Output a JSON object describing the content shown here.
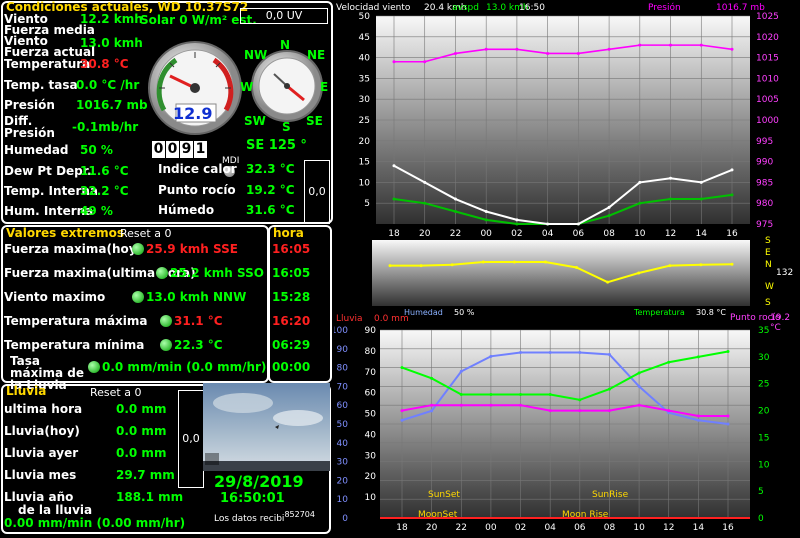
{
  "current": {
    "title": "Condiciones actuales, WD 10.37S72",
    "solar": "Solar 0 W/m² est.",
    "uv_box": "0,0 UV",
    "rows": [
      {
        "label": "Viento",
        "value": "12.2 kmh"
      },
      {
        "label": "Fuerza media",
        "value": ""
      },
      {
        "label": "Viento",
        "value": "13.0 kmh"
      },
      {
        "label": "Fuerza actual",
        "value": ""
      },
      {
        "label": "Temperatura",
        "value": "30.8 °C"
      },
      {
        "label": "Temp. tasa",
        "value": "0.0 °C /hr"
      },
      {
        "label": "Presión",
        "value": "1016.7 mb"
      },
      {
        "label": "Diff.",
        "value": "-0.1mb/hr"
      },
      {
        "label": "Presión",
        "value": ""
      },
      {
        "label": "Humedad",
        "value": "50 %"
      },
      {
        "label": "Dew Pt Depr.",
        "value": "11.6 °C"
      },
      {
        "label": "Temp. Interna",
        "value": "32.2 °C"
      },
      {
        "label": "Hum. Interna",
        "value": "49 %"
      }
    ],
    "gauge_value": "12.9",
    "counter": [
      "0",
      "0",
      "9",
      "1"
    ],
    "compass": {
      "N": "N",
      "NE": "NE",
      "E": "E",
      "SE": "SE",
      "S": "S",
      "SW": "SW",
      "W": "W",
      "NW": "NW"
    },
    "direction": "SE  125 °",
    "mdi": "MDI",
    "heat_label": "Indice calor",
    "heat_value": "32.3 °C",
    "dew_label": "Punto rocío",
    "dew_value": "19.2 °C",
    "humid_label": "Húmedo",
    "humid_value": "31.6 °C",
    "side_box": "0,0"
  },
  "extremes": {
    "title": "Valores extremos",
    "reset": "Reset a 0",
    "hora_title": "hora",
    "rows": [
      {
        "label": "Fuerza maxima(hoy)",
        "value": "25.9 kmh SSE",
        "time": "16:05",
        "red": true
      },
      {
        "label": "Fuerza maxima(ultima hora)",
        "value": "25.2 kmh SSO",
        "time": "16:05",
        "red": false
      },
      {
        "label": "Viento maximo",
        "value": "13.0 kmh NNW",
        "time": "15:28",
        "red": false
      },
      {
        "label": "Temperatura máxima",
        "value": "31.1 °C",
        "time": "16:20",
        "red": true
      },
      {
        "label": "Temperatura mínima",
        "value": "22.3 °C",
        "time": "06:29",
        "red": false
      },
      {
        "label": "Tasa máxima de la Lluvia",
        "value": "0.0 mm/min (0.0 mm/hr)",
        "time": "00:00",
        "red": false
      }
    ]
  },
  "rain": {
    "title": "Lluvia",
    "reset": "Reset a 0",
    "rows": [
      {
        "label": "ultima hora",
        "value": "0.0 mm"
      },
      {
        "label": "Lluvia(hoy)",
        "value": "0.0 mm"
      },
      {
        "label": "Lluvia ayer",
        "value": "0.0 mm"
      },
      {
        "label": "Lluvia mes",
        "value": "29.7 mm"
      },
      {
        "label": "Lluvia año",
        "value": "188.1 mm"
      },
      {
        "label": "de la lluvia",
        "value": ""
      }
    ],
    "rate": "0.00 mm/min (0.00 mm/hr)",
    "side_box": "0,0"
  },
  "footer": {
    "date": "29/8/2019",
    "time": "16:50:01",
    "received": "Los datos recibi",
    "received_num": "852704"
  },
  "colors": {
    "green": "#00ff00",
    "red": "#ff2020",
    "yellow": "#ffd800",
    "magenta": "#ff00ff"
  },
  "chart_data": [
    {
      "type": "line",
      "title": "",
      "header": {
        "wind_label": "Velocidad viento",
        "wind_val": "20.4 kmh",
        "avspd": "avspd",
        "avspd_val": "13.0 kmh",
        "time": "16:50",
        "pres_label": "Presión",
        "pres_val": "1016.7 mb"
      },
      "x": [
        "18",
        "20",
        "22",
        "00",
        "02",
        "04",
        "06",
        "08",
        "10",
        "12",
        "14",
        "16"
      ],
      "y_left": {
        "ylim": [
          0,
          50
        ],
        "ticks": [
          "5",
          "10",
          "15",
          "20",
          "25",
          "30",
          "35",
          "40",
          "45",
          "50"
        ]
      },
      "y_right": {
        "ylim": [
          975,
          1025
        ],
        "ticks": [
          "975",
          "980",
          "985",
          "990",
          "995",
          "1000",
          "1005",
          "1010",
          "1015",
          "1020",
          "1025"
        ]
      },
      "series": [
        {
          "name": "Presión",
          "color": "#ff00ff",
          "values": [
            1014,
            1014,
            1016,
            1017,
            1017,
            1016,
            1016,
            1017,
            1018,
            1018,
            1018,
            1017
          ]
        },
        {
          "name": "avspd",
          "color": "#00c000",
          "values": [
            6,
            5,
            3,
            1,
            0,
            0,
            0,
            2,
            5,
            6,
            6,
            7
          ]
        },
        {
          "name": "Velocidad viento",
          "color": "#ffffff",
          "values": [
            14,
            10,
            6,
            3,
            1,
            0,
            0,
            4,
            10,
            11,
            10,
            13
          ]
        }
      ]
    },
    {
      "type": "line",
      "title": "",
      "right_labels": [
        "S",
        "E",
        "N",
        "W",
        "S"
      ],
      "right_value": "132",
      "x": [
        "18",
        "20",
        "22",
        "00",
        "02",
        "04",
        "06",
        "08",
        "10",
        "12",
        "14",
        "16"
      ],
      "series": [
        {
          "name": "dirección",
          "color": "#ffff00",
          "values": [
            140,
            140,
            135,
            120,
            120,
            120,
            150,
            230,
            180,
            140,
            135,
            132
          ]
        }
      ]
    },
    {
      "type": "line",
      "header": {
        "hum_label": "Humedad",
        "hum_val": "50 %",
        "temp_label": "Temperatura",
        "temp_val": "30.8 °C",
        "rain_label": "Lluvia",
        "rain_val": "0.0 mm",
        "dew_label": "Punto rocío",
        "dew_val": "19.2 °C"
      },
      "x": [
        "18",
        "20",
        "22",
        "00",
        "02",
        "04",
        "06",
        "08",
        "10",
        "12",
        "14",
        "16"
      ],
      "y_left": {
        "ylim": [
          0,
          100
        ],
        "ticks": [
          "0",
          "10",
          "20",
          "30",
          "40",
          "50",
          "60",
          "70",
          "80",
          "90",
          "100"
        ]
      },
      "y_mid": {
        "ylim": [
          0,
          90
        ],
        "ticks": [
          "10",
          "20",
          "30",
          "40",
          "50",
          "60",
          "70",
          "80",
          "90"
        ]
      },
      "y_right": {
        "ylim": [
          0,
          35
        ],
        "ticks": [
          "0",
          "5",
          "10",
          "15",
          "20",
          "25",
          "30",
          "35"
        ]
      },
      "annotations": [
        "SunSet",
        "MoonSet",
        "SunRise",
        "Moon Rise"
      ],
      "series": [
        {
          "name": "Humedad",
          "color": "#7080ff",
          "values": [
            52,
            57,
            78,
            86,
            88,
            88,
            88,
            87,
            70,
            56,
            52,
            50
          ]
        },
        {
          "name": "Temperatura",
          "color": "#00ff00",
          "values": [
            28,
            26,
            23,
            23,
            23,
            23,
            22,
            24,
            27,
            29,
            30,
            31
          ]
        },
        {
          "name": "Punto rocío",
          "color": "#ff00ff",
          "values": [
            20,
            21,
            21,
            21,
            21,
            20,
            20,
            20,
            21,
            20,
            19,
            19
          ]
        }
      ]
    }
  ]
}
